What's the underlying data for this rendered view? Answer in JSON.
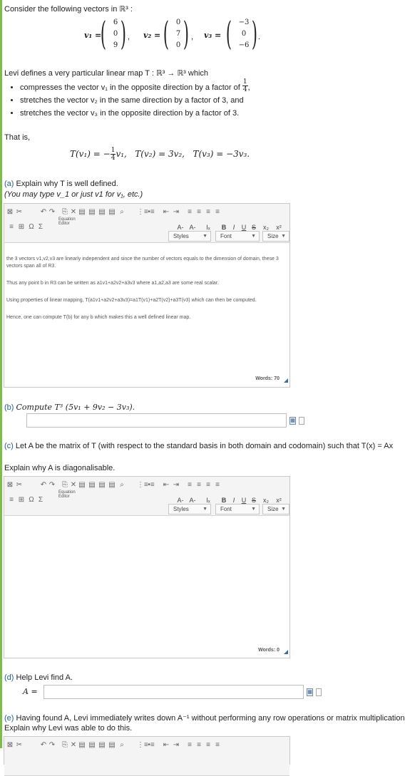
{
  "intro": "Consider the following vectors in ℝ³ :",
  "vectors": [
    {
      "label": "v₁ =",
      "entries": [
        "6",
        "0",
        "9"
      ],
      "sep": ","
    },
    {
      "label": "v₂ =",
      "entries": [
        "0",
        "7",
        "0"
      ],
      "sep": ","
    },
    {
      "label": "v₃ =",
      "entries": [
        "−3",
        "0",
        "−6"
      ],
      "sep": "."
    }
  ],
  "map_def": "Levi defines a very particular linear map T : ℝ³ → ℝ³ which",
  "bullets": [
    {
      "text": "compresses the vector v₁ in the opposite direction by a factor of",
      "frac_num": "1",
      "frac_den": "4",
      "tail": ","
    },
    {
      "text": "stretches the vector v₂ in the same direction by a factor of 3, and"
    },
    {
      "text": "stretches the vector v₃ in the opposite direction by a factor of 3."
    }
  ],
  "that_is": "That is,",
  "equations": {
    "lhs1": "T(v₁) = −",
    "frac_num": "1",
    "frac_den": "4",
    "rhs1": "v₁,",
    "eq2": "T(v₂) = 3v₂,",
    "eq3": "T(v₃) = −3v₃."
  },
  "part_a": {
    "label": "(a)",
    "question": "Explain why T is well defined.",
    "hint": "(You may type v_1 or just v1 for v₁, etc.)"
  },
  "editor_a": {
    "paragraphs": [
      "the 3 vectors v1,v2,v3 are linearly independent and since the number of vectors equals to the dimension of domain, these 3 vectors span all of R3.",
      "Thus any point b in R3 can be written as a1v1+a2v2+a3v3 where a1,a2,a3 are some real scalar.",
      "Using properties of linear mapping, T(a1v1+a2v2+a3v3)=a1T(v1)+a2T(v2)+a3T(v3) which can then be computed.",
      "Hence, one can compute T(b) for any b which makes this a well defined linear map."
    ],
    "words": "Words: 70"
  },
  "toolbar": {
    "row1": [
      "⊠",
      "✂",
      "↶",
      "↷",
      "⎘",
      "✕",
      "▤",
      "▤",
      "▤",
      "▤",
      "⌕",
      "⋮≡",
      "•≡",
      "⇤",
      "⇥",
      "≡",
      "≡",
      "≡",
      "≡"
    ],
    "row2": [
      "≡",
      "⊞",
      "Ω",
      "Σ"
    ],
    "equation_editor": [
      "Equation",
      "Editor"
    ],
    "format": [
      "A-",
      "A-",
      "Iₓ",
      "B",
      "I",
      "U",
      "S",
      "x₂",
      "x²"
    ],
    "styles": "Styles",
    "font": "Font",
    "size": "Size"
  },
  "part_b": {
    "label": "(b)",
    "question": "Compute T³ (5v₁ + 9v₂ − 3v₃)."
  },
  "part_c": {
    "label": "(c)",
    "question": "Let A be the matrix of T (with respect to the standard basis in both domain and codomain) such that T(x) = Ax",
    "sub": "Explain why A is diagonalisable."
  },
  "editor_c": {
    "words": "Words: 0"
  },
  "part_d": {
    "label": "(d)",
    "question": "Help Levi find A.",
    "answer_label": "A ="
  },
  "part_e": {
    "label": "(e)",
    "question": "Having found A, Levi immediately writes down A⁻¹ without performing any row operations or matrix multiplication.",
    "sub": "Explain why Levi was able to do this."
  },
  "colors": {
    "accent_bar": "#7ac142",
    "part_label": "#1f5fa8",
    "resize_handle": "#2f6db5"
  }
}
